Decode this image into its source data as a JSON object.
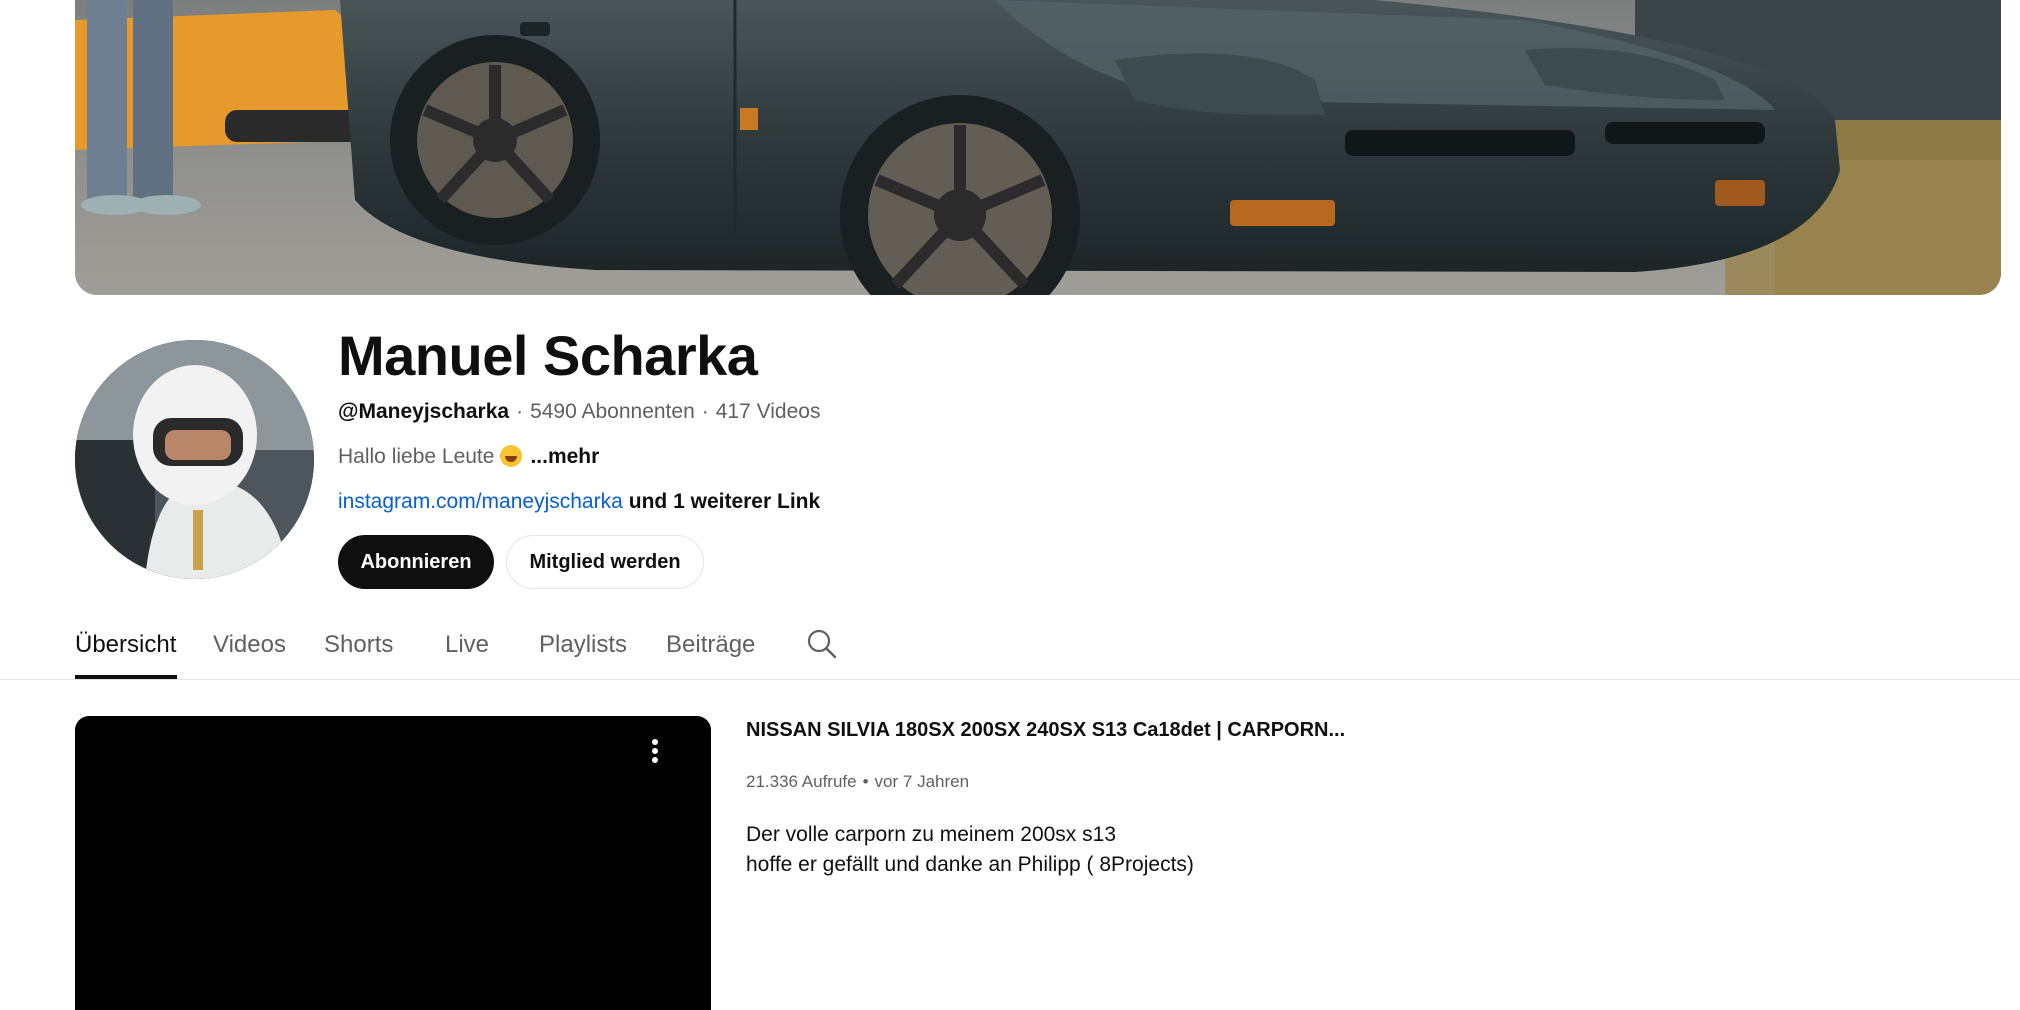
{
  "channel": {
    "name": "Manuel Scharka",
    "handle": "@Maneyjscharka",
    "subscribers": "5490 Abonnenten",
    "videos": "417 Videos",
    "meta_separator": "·",
    "description": "Hallo liebe Leute",
    "description_more": "...mehr",
    "link_text": "instagram.com/maneyjscharka",
    "more_links": "und 1 weiterer Link"
  },
  "buttons": {
    "subscribe": "Abonnieren",
    "member": "Mitglied werden"
  },
  "tabs": [
    {
      "label": "Übersicht",
      "active": true
    },
    {
      "label": "Videos",
      "active": false
    },
    {
      "label": "Shorts",
      "active": false
    },
    {
      "label": "Live",
      "active": false
    },
    {
      "label": "Playlists",
      "active": false
    },
    {
      "label": "Beiträge",
      "active": false
    }
  ],
  "icons": {
    "search": "search-icon",
    "more": "more-vert-icon",
    "emoji": "grinning-face-emoji"
  },
  "featured_video": {
    "title": "NISSAN SILVIA 180SX 200SX 240SX S13 Ca18det | CARPORN...",
    "views": "21.336 Aufrufe",
    "separator": "•",
    "age": "vor 7 Jahren",
    "description_lines": [
      "Der volle carporn zu meinem 200sx s13",
      "hoffe er gefällt und danke an Philipp ( 8Projects)"
    ]
  },
  "colors": {
    "text_primary": "#0f0f0f",
    "text_secondary": "#606060",
    "link": "#065fd4",
    "subscribe_bg": "#0f0f0f",
    "divider": "#e5e5e5"
  }
}
